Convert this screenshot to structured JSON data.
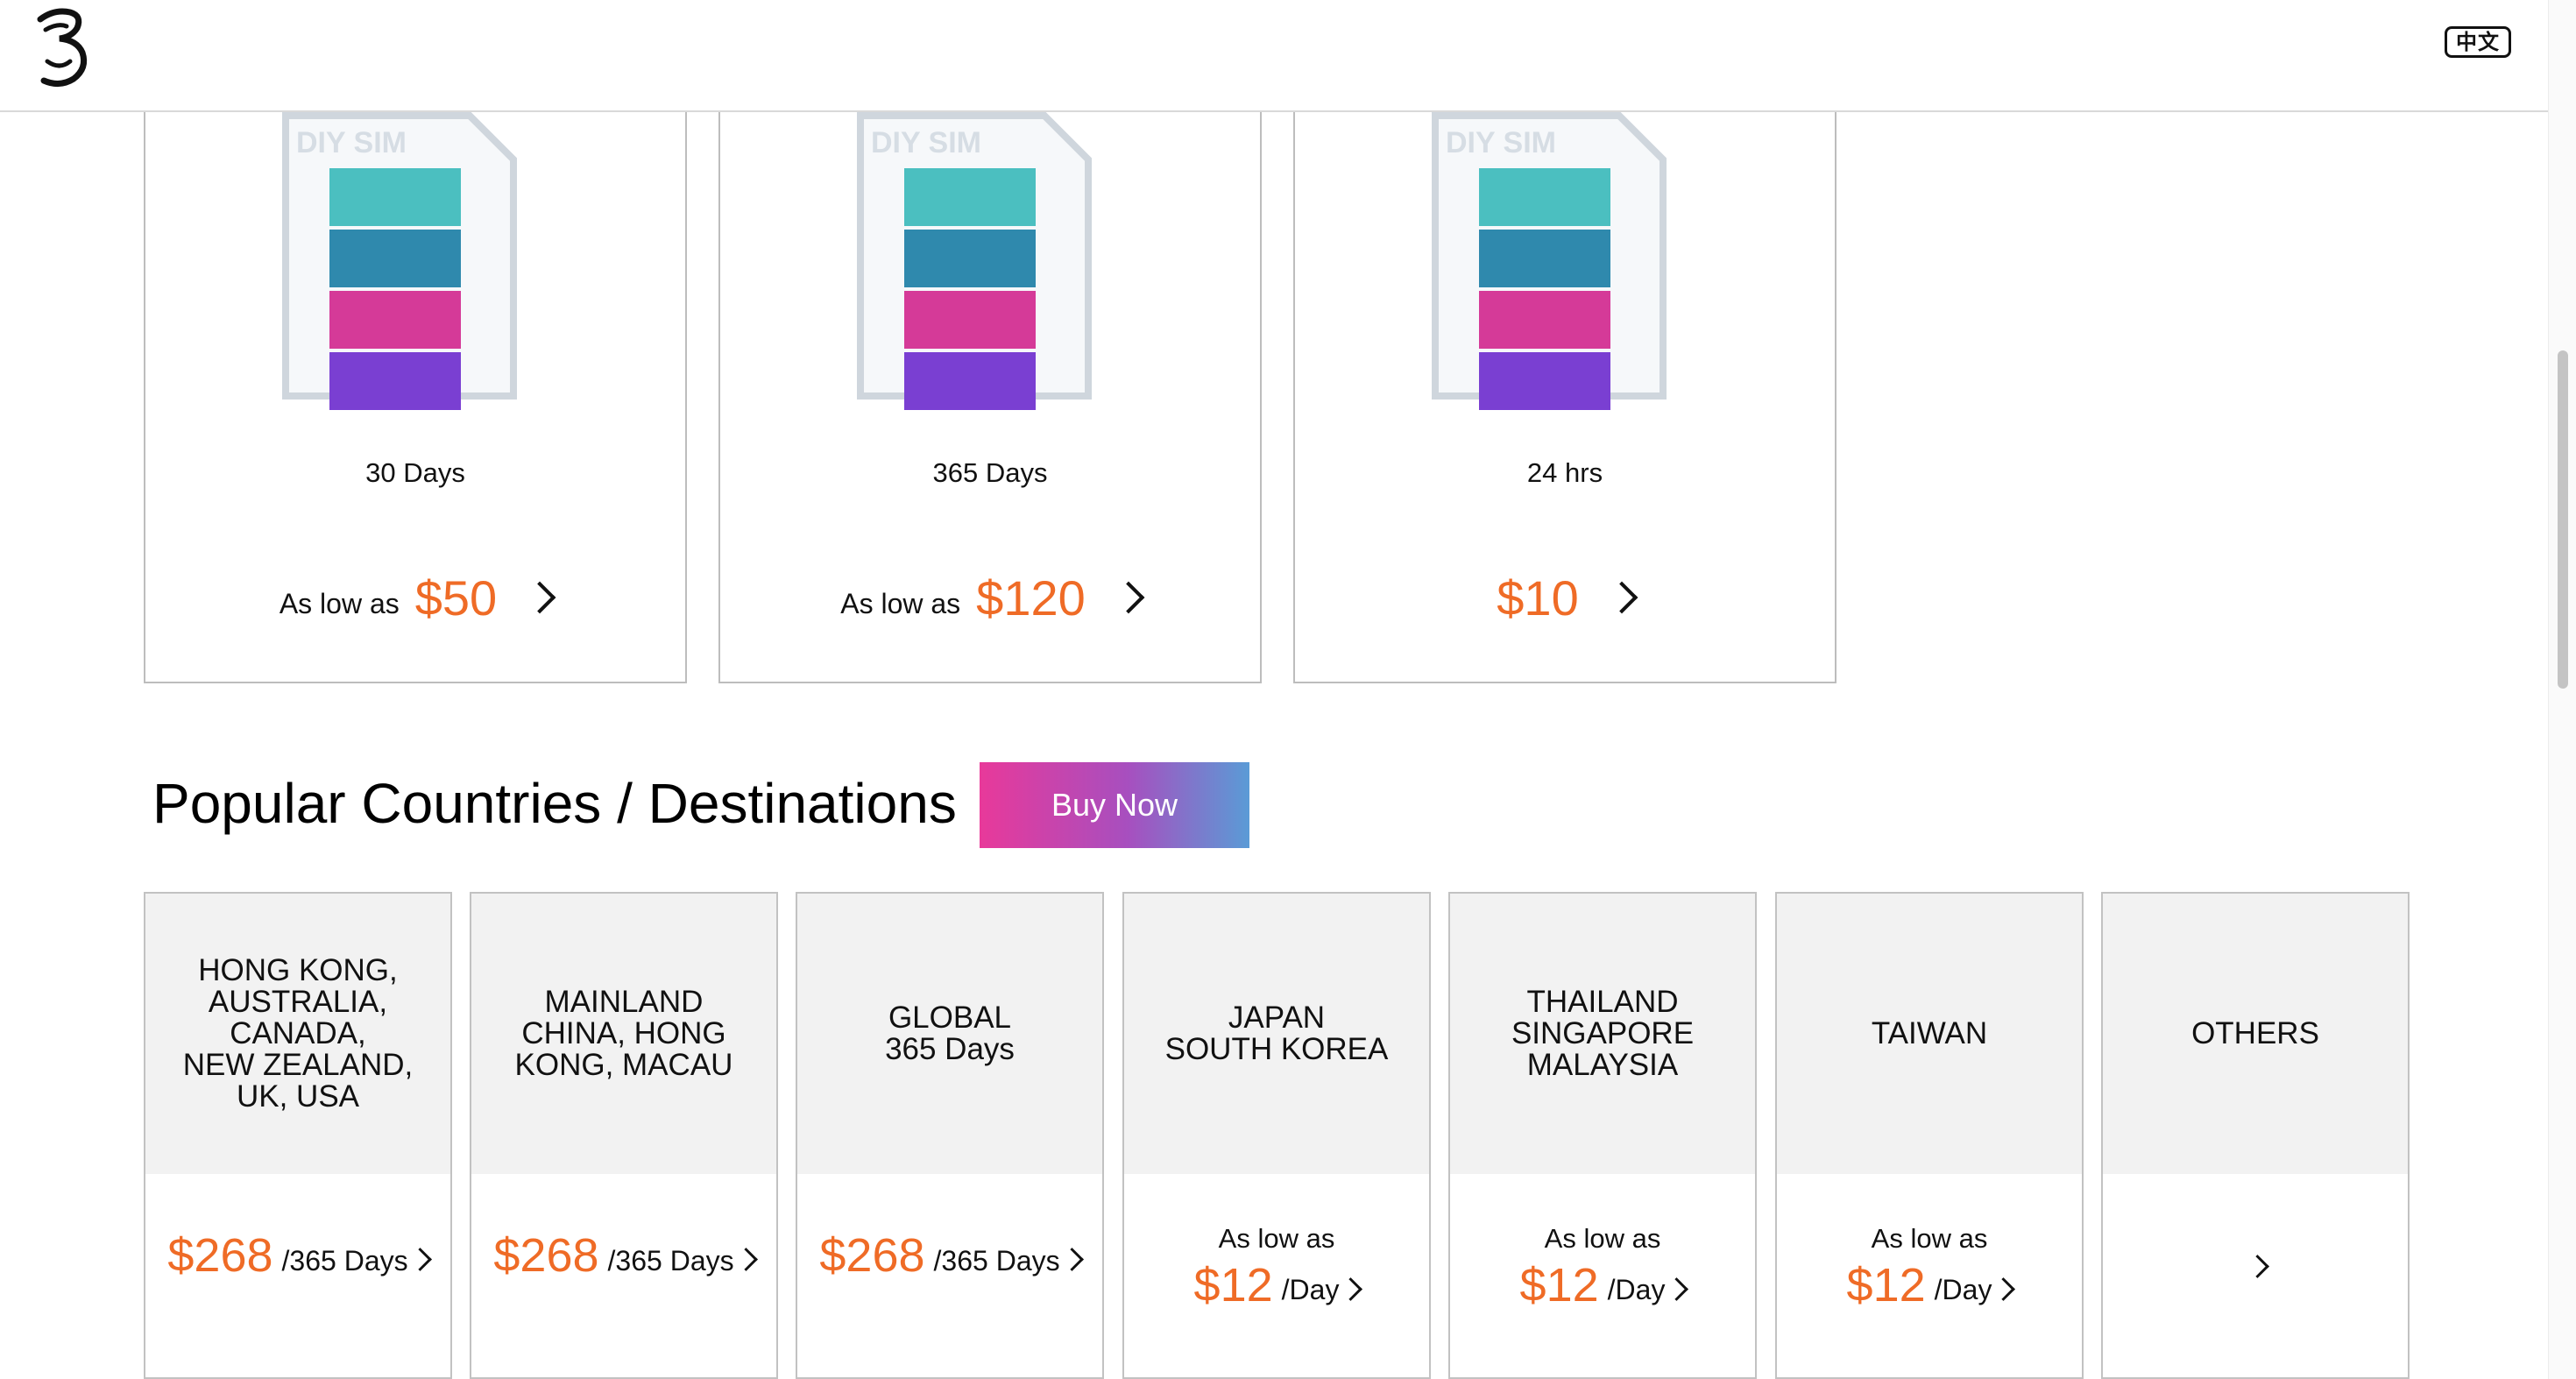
{
  "header": {
    "logo_icon": "three-logo-icon",
    "lang_label": "中文"
  },
  "plans": [
    {
      "image_text": "DIY SIM",
      "name": "30 Days",
      "prefix": "As low as",
      "price": "$50"
    },
    {
      "image_text": "DIY SIM",
      "name": "365 Days",
      "prefix": "As low as",
      "price": "$120"
    },
    {
      "image_text": "DIY SIM",
      "name": "24 hrs",
      "prefix": "",
      "price": "$10"
    }
  ],
  "section": {
    "title": "Popular Countries / Destinations",
    "buy_now": "Buy Now"
  },
  "destinations": [
    {
      "name": "HONG KONG,\nAUSTRALIA,\nCANADA,\nNEW ZEALAND,\nUK, USA",
      "prefix": "",
      "price": "$268",
      "unit": "/365 Days"
    },
    {
      "name": "MAINLAND\nCHINA, HONG\nKONG, MACAU",
      "prefix": "",
      "price": "$268",
      "unit": "/365 Days"
    },
    {
      "name": "GLOBAL\n365 Days",
      "prefix": "",
      "price": "$268",
      "unit": "/365 Days"
    },
    {
      "name": "JAPAN\nSOUTH KOREA",
      "prefix": "As low as",
      "price": "$12",
      "unit": "/Day"
    },
    {
      "name": "THAILAND\nSINGAPORE\nMALAYSIA",
      "prefix": "As low as",
      "price": "$12",
      "unit": "/Day"
    },
    {
      "name": "TAIWAN",
      "prefix": "As low as",
      "price": "$12",
      "unit": "/Day"
    },
    {
      "name": "OTHERS",
      "prefix": "",
      "price": "",
      "unit": ""
    }
  ],
  "colors": {
    "accent": "#ef6b26",
    "buy_gradient": [
      "#e8399a",
      "#a74fbf",
      "#5a9bd6"
    ]
  }
}
